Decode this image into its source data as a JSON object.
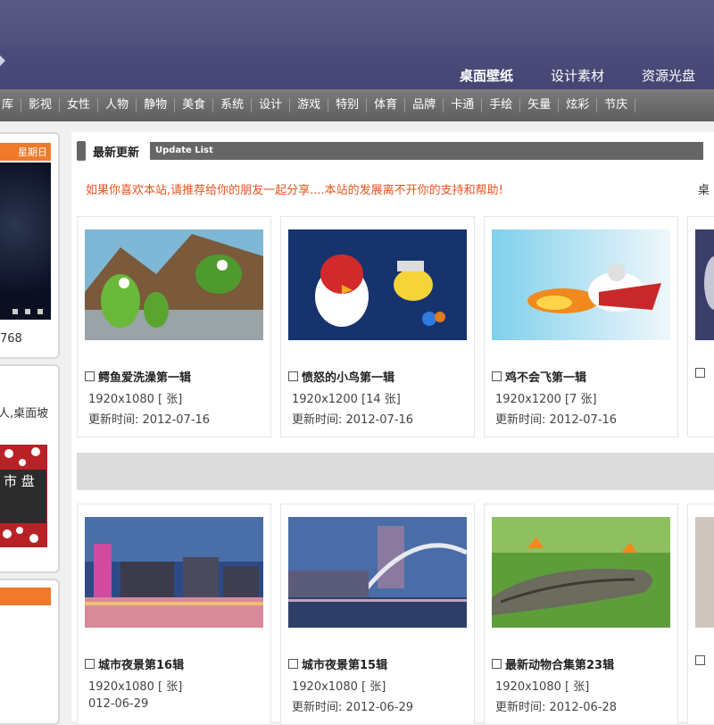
{
  "top_nav": {
    "items": [
      "桌面壁纸",
      "设计素材",
      "资源光盘"
    ],
    "active": "桌面壁纸"
  },
  "categories": [
    "库",
    "影视",
    "女性",
    "人物",
    "静物",
    "美食",
    "系统",
    "设计",
    "游戏",
    "特别",
    "体育",
    "品牌",
    "卡通",
    "手绘",
    "矢量",
    "炫彩",
    "节庆"
  ],
  "sidebar": {
    "badge": "星期日",
    "number": "768",
    "text": "人,桌面坡",
    "poster_text": "市 盘"
  },
  "section": {
    "title": "最新更新",
    "subtitle": "Update List"
  },
  "notice": "如果你喜欢本站,请推荐给你的朋友一起分享....本站的发展离不开你的支持和帮助!",
  "more_link": "桌",
  "cards_row1": [
    {
      "name": "鳄鱼爱洗澡第一辑",
      "size": "1920x1080 [ 张]",
      "date": "更新时间: 2012-07-16"
    },
    {
      "name": "愤怒的小鸟第一辑",
      "size": "1920x1200 [14 张]",
      "date": "更新时间: 2012-07-16"
    },
    {
      "name": "鸡不会飞第一辑",
      "size": "1920x1200 [7 张]",
      "date": "更新时间: 2012-07-16"
    },
    {
      "name": "",
      "size": "",
      "date": ""
    }
  ],
  "cards_row2": [
    {
      "name": "城市夜景第16辑",
      "size": "1920x1080 [ 张]",
      "date": "012-06-29"
    },
    {
      "name": "城市夜景第15辑",
      "size": "1920x1080 [ 张]",
      "date": "更新时间: 2012-06-29"
    },
    {
      "name": "最新动物合集第23辑",
      "size": "1920x1080 [ 张]",
      "date": "更新时间: 2012-06-28"
    },
    {
      "name": "",
      "size": "",
      "date": ""
    }
  ],
  "colors": {
    "header": "#5b5b88",
    "catbar": "#6b6b6b",
    "accent": "#f07a2a",
    "notice": "#e6531e"
  }
}
